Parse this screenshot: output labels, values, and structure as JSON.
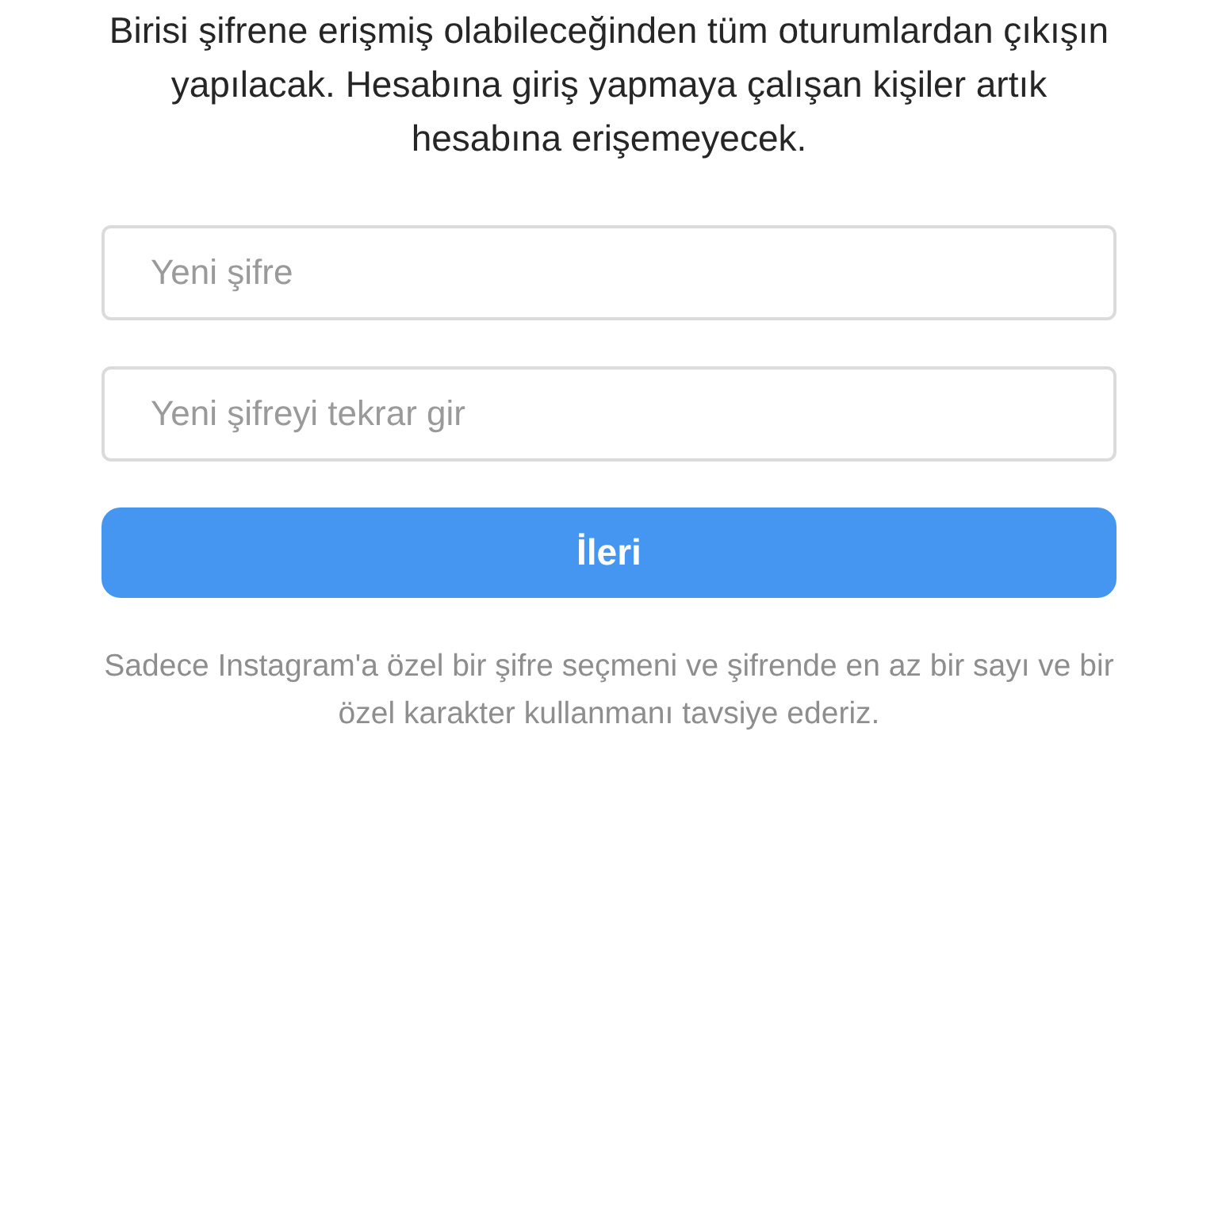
{
  "message": "Birisi şifrene erişmiş olabileceğinden tüm oturumlardan çıkışın yapılacak. Hesabına giriş yapmaya çalışan kişiler artık hesabına erişemeyecek.",
  "fields": [
    {
      "placeholder": "Yeni şifre"
    },
    {
      "placeholder": "Yeni şifreyi tekrar gir"
    }
  ],
  "button": {
    "label": "İleri"
  },
  "hint": "Sadece Instagram'a özel bir şifre seçmeni ve şifrende en az bir sayı ve bir özel karakter kullanmanı tavsiye ederiz."
}
